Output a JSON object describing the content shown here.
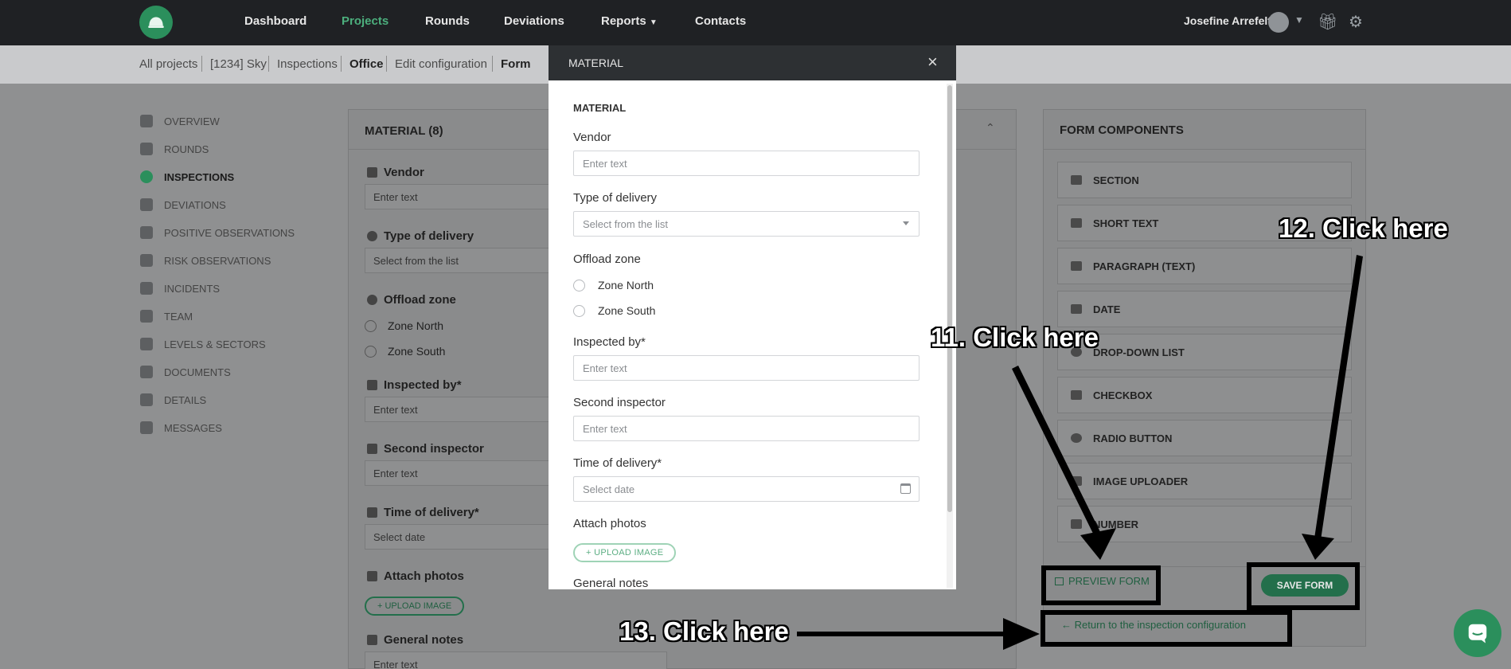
{
  "nav": {
    "items": [
      "Dashboard",
      "Projects",
      "Rounds",
      "Deviations",
      "Reports",
      "Contacts"
    ],
    "user_name": "Josefine Arrefelt"
  },
  "breadcrumb": [
    "All projects",
    "[1234] Sky",
    "Inspections",
    "Office",
    "Edit configuration",
    "Form"
  ],
  "sidebar": [
    "OVERVIEW",
    "ROUNDS",
    "INSPECTIONS",
    "DEVIATIONS",
    "POSITIVE OBSERVATIONS",
    "RISK OBSERVATIONS",
    "INCIDENTS",
    "TEAM",
    "LEVELS & SECTORS",
    "DOCUMENTS",
    "DETAILS",
    "MESSAGES"
  ],
  "form_panel": {
    "title": "MATERIAL (8)",
    "fields": {
      "vendor": "Vendor",
      "type_of_delivery": "Type of delivery",
      "offload_zone": "Offload zone",
      "inspected_by": "Inspected by*",
      "second_inspector": "Second inspector",
      "time_of_delivery": "Time of delivery*",
      "attach_photos": "Attach photos",
      "general_notes": "General notes"
    },
    "placeholders": {
      "text": "Enter text",
      "list": "Select from the list",
      "date": "Select date"
    },
    "radio_options": [
      "Zone North",
      "Zone South"
    ],
    "upload_label": "UPLOAD IMAGE"
  },
  "components": {
    "title": "FORM COMPONENTS",
    "items": [
      "SECTION",
      "SHORT TEXT",
      "PARAGRAPH (TEXT)",
      "DATE",
      "DROP-DOWN LIST",
      "CHECKBOX",
      "RADIO BUTTON",
      "IMAGE UPLOADER",
      "NUMBER"
    ],
    "preview_label": "PREVIEW FORM",
    "save_label": "SAVE FORM",
    "return_label": "Return to the inspection configuration"
  },
  "modal": {
    "title": "MATERIAL",
    "section": "MATERIAL",
    "close": "×",
    "fields": {
      "vendor": "Vendor",
      "type_of_delivery": "Type of delivery",
      "offload_zone": "Offload zone",
      "inspected_by": "Inspected by*",
      "second_inspector": "Second inspector",
      "time_of_delivery": "Time of delivery*",
      "attach_photos": "Attach photos",
      "general_notes": "General notes"
    },
    "placeholders": {
      "text": "Enter text",
      "list": "Select from the list",
      "date": "Select date"
    },
    "radio_options": [
      "Zone North",
      "Zone South"
    ],
    "upload_label": "+ UPLOAD IMAGE"
  },
  "annotations": {
    "step11": "11. Click here",
    "step12": "12. Click here",
    "step13": "13. Click here"
  }
}
